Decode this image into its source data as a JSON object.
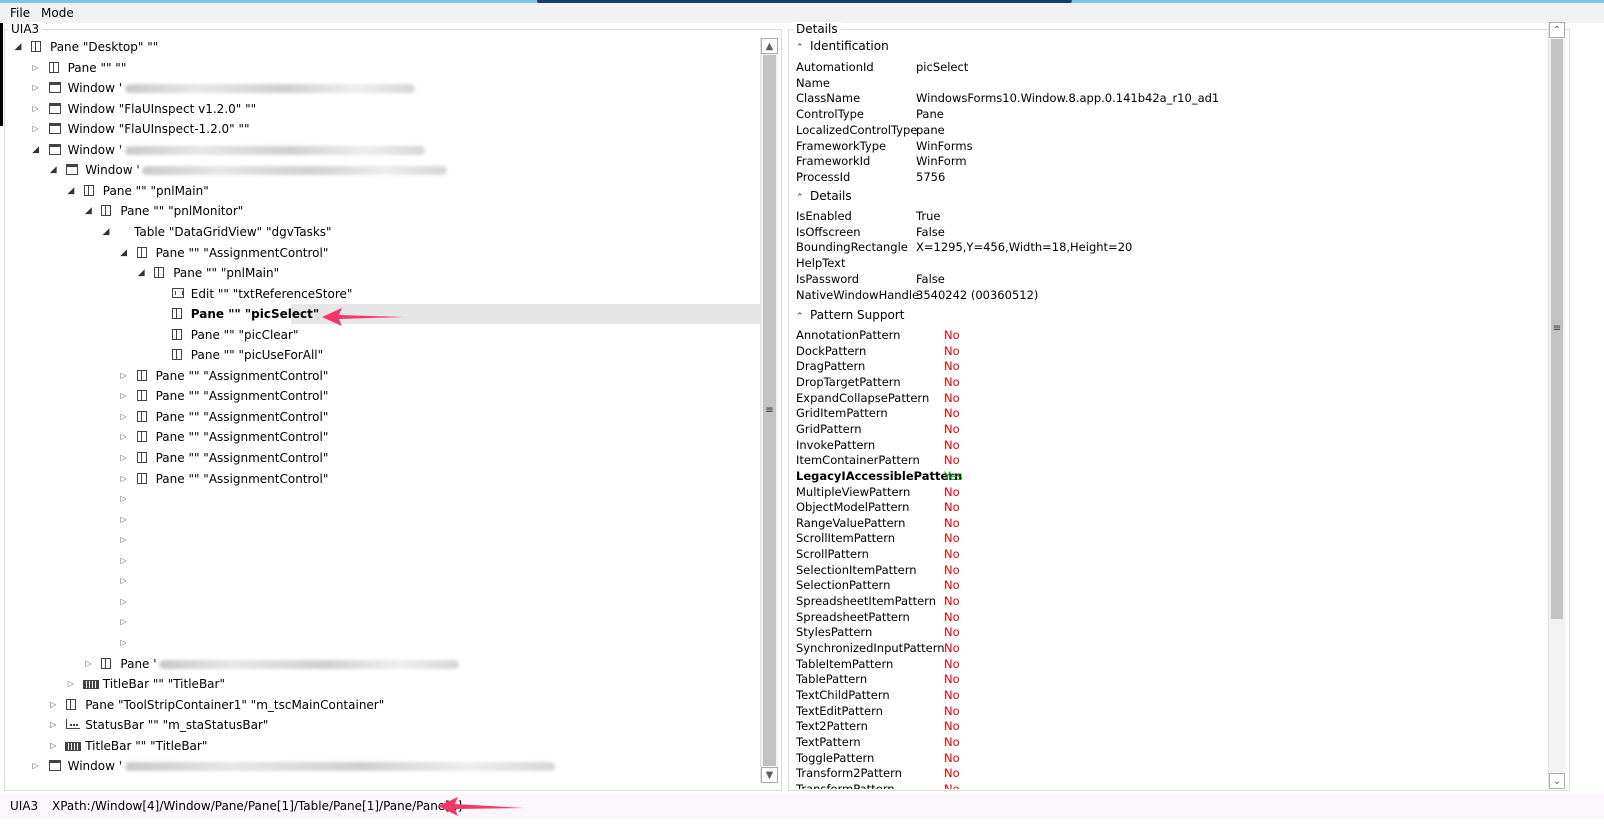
{
  "menu": [
    {
      "label": "File"
    },
    {
      "label": "Mode"
    }
  ],
  "left_panel": {
    "title": "UIA3",
    "tree": [
      {
        "depth": 0,
        "exp": "open",
        "icon": "pane",
        "text": "Pane \"Desktop\" \"\"",
        "blur_after": 0
      },
      {
        "depth": 1,
        "exp": "closed",
        "icon": "pane",
        "text": "Pane \"\" \"\"",
        "blur_after": 0
      },
      {
        "depth": 1,
        "exp": "closed",
        "icon": "window",
        "text": "Window '",
        "blur_after": 290
      },
      {
        "depth": 1,
        "exp": "closed",
        "icon": "window",
        "text": "Window \"FlaUInspect v1.2.0\" \"\"",
        "blur_after": 0
      },
      {
        "depth": 1,
        "exp": "closed",
        "icon": "window",
        "text": "Window \"FlaUInspect-1.2.0\" \"\"",
        "blur_after": 0
      },
      {
        "depth": 1,
        "exp": "open",
        "icon": "window",
        "text": "Window '",
        "blur_after": 300
      },
      {
        "depth": 2,
        "exp": "open",
        "icon": "window",
        "text": "Window '",
        "blur_after": 305
      },
      {
        "depth": 3,
        "exp": "open",
        "icon": "pane",
        "text": "Pane \"\" \"pnlMain\"",
        "blur_after": 0
      },
      {
        "depth": 4,
        "exp": "open",
        "icon": "pane",
        "text": "Pane \"\" \"pnlMonitor\"",
        "blur_after": 0
      },
      {
        "depth": 5,
        "exp": "open",
        "icon": "none",
        "text": "Table \"DataGridView\" \"dgvTasks\"",
        "blur_after": 0
      },
      {
        "depth": 6,
        "exp": "open",
        "icon": "pane",
        "text": "Pane \"\" \"AssignmentControl\"",
        "blur_after": 0
      },
      {
        "depth": 7,
        "exp": "open",
        "icon": "pane",
        "text": "Pane \"\" \"pnlMain\"",
        "blur_after": 0
      },
      {
        "depth": 8,
        "exp": "none",
        "icon": "edit",
        "text": "Edit \"\" \"txtReferenceStore\"",
        "blur_after": 0
      },
      {
        "depth": 8,
        "exp": "none",
        "icon": "pane",
        "text": "Pane \"\" \"picSelect\"",
        "blur_after": 0,
        "selected": true
      },
      {
        "depth": 8,
        "exp": "none",
        "icon": "pane",
        "text": "Pane \"\" \"picClear\"",
        "blur_after": 0
      },
      {
        "depth": 8,
        "exp": "none",
        "icon": "pane",
        "text": "Pane \"\" \"picUseForAll\"",
        "blur_after": 0
      },
      {
        "depth": 6,
        "exp": "closed",
        "icon": "pane",
        "text": "Pane \"\" \"AssignmentControl\"",
        "blur_after": 0
      },
      {
        "depth": 6,
        "exp": "closed",
        "icon": "pane",
        "text": "Pane \"\" \"AssignmentControl\"",
        "blur_after": 0
      },
      {
        "depth": 6,
        "exp": "closed",
        "icon": "pane",
        "text": "Pane \"\" \"AssignmentControl\"",
        "blur_after": 0
      },
      {
        "depth": 6,
        "exp": "closed",
        "icon": "pane",
        "text": "Pane \"\" \"AssignmentControl\"",
        "blur_after": 0
      },
      {
        "depth": 6,
        "exp": "closed",
        "icon": "pane",
        "text": "Pane \"\" \"AssignmentControl\"",
        "blur_after": 0
      },
      {
        "depth": 6,
        "exp": "closed",
        "icon": "pane",
        "text": "Pane \"\" \"AssignmentControl\"",
        "blur_after": 0
      },
      {
        "depth": 6,
        "exp": "closed",
        "icon": "none",
        "text": "",
        "blur_after": 0
      },
      {
        "depth": 6,
        "exp": "closed",
        "icon": "none",
        "text": "",
        "blur_after": 0
      },
      {
        "depth": 6,
        "exp": "closed",
        "icon": "none",
        "text": "",
        "blur_after": 0
      },
      {
        "depth": 6,
        "exp": "closed",
        "icon": "none",
        "text": "",
        "blur_after": 0
      },
      {
        "depth": 6,
        "exp": "closed",
        "icon": "none",
        "text": "",
        "blur_after": 0
      },
      {
        "depth": 6,
        "exp": "closed",
        "icon": "none",
        "text": "",
        "blur_after": 0
      },
      {
        "depth": 6,
        "exp": "closed",
        "icon": "none",
        "text": "",
        "blur_after": 0
      },
      {
        "depth": 6,
        "exp": "closed",
        "icon": "none",
        "text": "",
        "blur_after": 0
      },
      {
        "depth": 4,
        "exp": "closed",
        "icon": "pane",
        "text": "Pane '",
        "blur_after": 300
      },
      {
        "depth": 3,
        "exp": "closed",
        "icon": "titlebar",
        "text": "TitleBar \"\" \"TitleBar\"",
        "blur_after": 0
      },
      {
        "depth": 2,
        "exp": "closed",
        "icon": "pane",
        "text": "Pane \"ToolStripContainer1\" \"m_tscMainContainer\"",
        "blur_after": 0
      },
      {
        "depth": 2,
        "exp": "closed",
        "icon": "statusbar",
        "text": "StatusBar \"\" \"m_staStatusBar\"",
        "blur_after": 0
      },
      {
        "depth": 2,
        "exp": "closed",
        "icon": "titlebar",
        "text": "TitleBar \"\" \"TitleBar\"",
        "blur_after": 0
      },
      {
        "depth": 1,
        "exp": "closed",
        "icon": "window",
        "text": "Window '",
        "blur_after": 430
      }
    ]
  },
  "details": {
    "title": "Details",
    "identification": {
      "header": "Identification",
      "rows": [
        {
          "name": "AutomationId",
          "value": "picSelect"
        },
        {
          "name": "Name",
          "value": ""
        },
        {
          "name": "ClassName",
          "value": "WindowsForms10.Window.8.app.0.141b42a_r10_ad1"
        },
        {
          "name": "ControlType",
          "value": "Pane"
        },
        {
          "name": "LocalizedControlType",
          "value": "pane"
        },
        {
          "name": "FrameworkType",
          "value": "WinForms"
        },
        {
          "name": "FrameworkId",
          "value": "WinForm"
        },
        {
          "name": "ProcessId",
          "value": "5756"
        }
      ]
    },
    "details_section": {
      "header": "Details",
      "rows": [
        {
          "name": "IsEnabled",
          "value": "True"
        },
        {
          "name": "IsOffscreen",
          "value": "False"
        },
        {
          "name": "BoundingRectangle",
          "value": "X=1295,Y=456,Width=18,Height=20"
        },
        {
          "name": "HelpText",
          "value": ""
        },
        {
          "name": "IsPassword",
          "value": "False"
        },
        {
          "name": "NativeWindowHandle",
          "value": "3540242 (00360512)"
        }
      ]
    },
    "pattern_support": {
      "header": "Pattern Support",
      "rows": [
        {
          "name": "AnnotationPattern",
          "value": "No"
        },
        {
          "name": "DockPattern",
          "value": "No"
        },
        {
          "name": "DragPattern",
          "value": "No"
        },
        {
          "name": "DropTargetPattern",
          "value": "No"
        },
        {
          "name": "ExpandCollapsePattern",
          "value": "No"
        },
        {
          "name": "GridItemPattern",
          "value": "No"
        },
        {
          "name": "GridPattern",
          "value": "No"
        },
        {
          "name": "InvokePattern",
          "value": "No"
        },
        {
          "name": "ItemContainerPattern",
          "value": "No"
        },
        {
          "name": "LegacyIAccessiblePattern",
          "value": "Yes"
        },
        {
          "name": "MultipleViewPattern",
          "value": "No"
        },
        {
          "name": "ObjectModelPattern",
          "value": "No"
        },
        {
          "name": "RangeValuePattern",
          "value": "No"
        },
        {
          "name": "ScrollItemPattern",
          "value": "No"
        },
        {
          "name": "ScrollPattern",
          "value": "No"
        },
        {
          "name": "SelectionItemPattern",
          "value": "No"
        },
        {
          "name": "SelectionPattern",
          "value": "No"
        },
        {
          "name": "SpreadsheetItemPattern",
          "value": "No"
        },
        {
          "name": "SpreadsheetPattern",
          "value": "No"
        },
        {
          "name": "StylesPattern",
          "value": "No"
        },
        {
          "name": "SynchronizedInputPattern",
          "value": "No"
        },
        {
          "name": "TableItemPattern",
          "value": "No"
        },
        {
          "name": "TablePattern",
          "value": "No"
        },
        {
          "name": "TextChildPattern",
          "value": "No"
        },
        {
          "name": "TextEditPattern",
          "value": "No"
        },
        {
          "name": "Text2Pattern",
          "value": "No"
        },
        {
          "name": "TextPattern",
          "value": "No"
        },
        {
          "name": "TogglePattern",
          "value": "No"
        },
        {
          "name": "Transform2Pattern",
          "value": "No"
        },
        {
          "name": "TransformPattern",
          "value": "No"
        }
      ]
    }
  },
  "status_bar": {
    "mode": "UIA3",
    "xpath_label": "XPath:",
    "xpath": "/Window[4]/Window/Pane/Pane[1]/Table/Pane[1]/Pane/Pane[1]"
  },
  "colors": {
    "accent_arrow": "#f0386b",
    "pattern_no": "#e00000",
    "pattern_yes": "#109c10",
    "selection": "#e6e6e6"
  },
  "icons": [
    "expand-arrow-icon",
    "collapse-arrow-icon",
    "pane-icon",
    "window-icon",
    "edit-icon",
    "titlebar-icon",
    "statusbar-icon",
    "chevron-up-icon",
    "scroll-up-arrow-icon",
    "scroll-down-arrow-icon",
    "scroll-grip-icon",
    "pointer-arrow-icon"
  ]
}
